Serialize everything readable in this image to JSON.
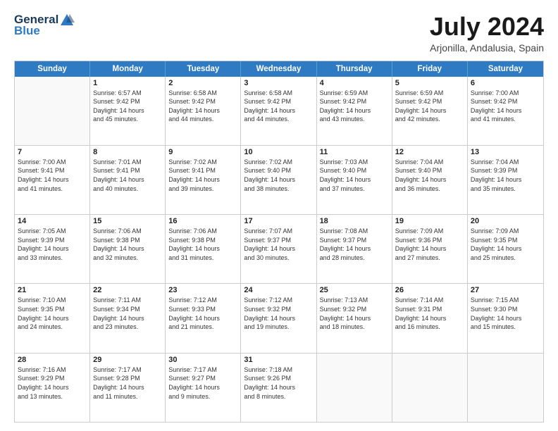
{
  "header": {
    "logo_general": "General",
    "logo_blue": "Blue",
    "month_title": "July 2024",
    "subtitle": "Arjonilla, Andalusia, Spain"
  },
  "calendar": {
    "days": [
      "Sunday",
      "Monday",
      "Tuesday",
      "Wednesday",
      "Thursday",
      "Friday",
      "Saturday"
    ],
    "rows": [
      [
        {
          "day": "",
          "lines": []
        },
        {
          "day": "1",
          "lines": [
            "Sunrise: 6:57 AM",
            "Sunset: 9:42 PM",
            "Daylight: 14 hours",
            "and 45 minutes."
          ]
        },
        {
          "day": "2",
          "lines": [
            "Sunrise: 6:58 AM",
            "Sunset: 9:42 PM",
            "Daylight: 14 hours",
            "and 44 minutes."
          ]
        },
        {
          "day": "3",
          "lines": [
            "Sunrise: 6:58 AM",
            "Sunset: 9:42 PM",
            "Daylight: 14 hours",
            "and 44 minutes."
          ]
        },
        {
          "day": "4",
          "lines": [
            "Sunrise: 6:59 AM",
            "Sunset: 9:42 PM",
            "Daylight: 14 hours",
            "and 43 minutes."
          ]
        },
        {
          "day": "5",
          "lines": [
            "Sunrise: 6:59 AM",
            "Sunset: 9:42 PM",
            "Daylight: 14 hours",
            "and 42 minutes."
          ]
        },
        {
          "day": "6",
          "lines": [
            "Sunrise: 7:00 AM",
            "Sunset: 9:42 PM",
            "Daylight: 14 hours",
            "and 41 minutes."
          ]
        }
      ],
      [
        {
          "day": "7",
          "lines": [
            "Sunrise: 7:00 AM",
            "Sunset: 9:41 PM",
            "Daylight: 14 hours",
            "and 41 minutes."
          ]
        },
        {
          "day": "8",
          "lines": [
            "Sunrise: 7:01 AM",
            "Sunset: 9:41 PM",
            "Daylight: 14 hours",
            "and 40 minutes."
          ]
        },
        {
          "day": "9",
          "lines": [
            "Sunrise: 7:02 AM",
            "Sunset: 9:41 PM",
            "Daylight: 14 hours",
            "and 39 minutes."
          ]
        },
        {
          "day": "10",
          "lines": [
            "Sunrise: 7:02 AM",
            "Sunset: 9:40 PM",
            "Daylight: 14 hours",
            "and 38 minutes."
          ]
        },
        {
          "day": "11",
          "lines": [
            "Sunrise: 7:03 AM",
            "Sunset: 9:40 PM",
            "Daylight: 14 hours",
            "and 37 minutes."
          ]
        },
        {
          "day": "12",
          "lines": [
            "Sunrise: 7:04 AM",
            "Sunset: 9:40 PM",
            "Daylight: 14 hours",
            "and 36 minutes."
          ]
        },
        {
          "day": "13",
          "lines": [
            "Sunrise: 7:04 AM",
            "Sunset: 9:39 PM",
            "Daylight: 14 hours",
            "and 35 minutes."
          ]
        }
      ],
      [
        {
          "day": "14",
          "lines": [
            "Sunrise: 7:05 AM",
            "Sunset: 9:39 PM",
            "Daylight: 14 hours",
            "and 33 minutes."
          ]
        },
        {
          "day": "15",
          "lines": [
            "Sunrise: 7:06 AM",
            "Sunset: 9:38 PM",
            "Daylight: 14 hours",
            "and 32 minutes."
          ]
        },
        {
          "day": "16",
          "lines": [
            "Sunrise: 7:06 AM",
            "Sunset: 9:38 PM",
            "Daylight: 14 hours",
            "and 31 minutes."
          ]
        },
        {
          "day": "17",
          "lines": [
            "Sunrise: 7:07 AM",
            "Sunset: 9:37 PM",
            "Daylight: 14 hours",
            "and 30 minutes."
          ]
        },
        {
          "day": "18",
          "lines": [
            "Sunrise: 7:08 AM",
            "Sunset: 9:37 PM",
            "Daylight: 14 hours",
            "and 28 minutes."
          ]
        },
        {
          "day": "19",
          "lines": [
            "Sunrise: 7:09 AM",
            "Sunset: 9:36 PM",
            "Daylight: 14 hours",
            "and 27 minutes."
          ]
        },
        {
          "day": "20",
          "lines": [
            "Sunrise: 7:09 AM",
            "Sunset: 9:35 PM",
            "Daylight: 14 hours",
            "and 25 minutes."
          ]
        }
      ],
      [
        {
          "day": "21",
          "lines": [
            "Sunrise: 7:10 AM",
            "Sunset: 9:35 PM",
            "Daylight: 14 hours",
            "and 24 minutes."
          ]
        },
        {
          "day": "22",
          "lines": [
            "Sunrise: 7:11 AM",
            "Sunset: 9:34 PM",
            "Daylight: 14 hours",
            "and 23 minutes."
          ]
        },
        {
          "day": "23",
          "lines": [
            "Sunrise: 7:12 AM",
            "Sunset: 9:33 PM",
            "Daylight: 14 hours",
            "and 21 minutes."
          ]
        },
        {
          "day": "24",
          "lines": [
            "Sunrise: 7:12 AM",
            "Sunset: 9:32 PM",
            "Daylight: 14 hours",
            "and 19 minutes."
          ]
        },
        {
          "day": "25",
          "lines": [
            "Sunrise: 7:13 AM",
            "Sunset: 9:32 PM",
            "Daylight: 14 hours",
            "and 18 minutes."
          ]
        },
        {
          "day": "26",
          "lines": [
            "Sunrise: 7:14 AM",
            "Sunset: 9:31 PM",
            "Daylight: 14 hours",
            "and 16 minutes."
          ]
        },
        {
          "day": "27",
          "lines": [
            "Sunrise: 7:15 AM",
            "Sunset: 9:30 PM",
            "Daylight: 14 hours",
            "and 15 minutes."
          ]
        }
      ],
      [
        {
          "day": "28",
          "lines": [
            "Sunrise: 7:16 AM",
            "Sunset: 9:29 PM",
            "Daylight: 14 hours",
            "and 13 minutes."
          ]
        },
        {
          "day": "29",
          "lines": [
            "Sunrise: 7:17 AM",
            "Sunset: 9:28 PM",
            "Daylight: 14 hours",
            "and 11 minutes."
          ]
        },
        {
          "day": "30",
          "lines": [
            "Sunrise: 7:17 AM",
            "Sunset: 9:27 PM",
            "Daylight: 14 hours",
            "and 9 minutes."
          ]
        },
        {
          "day": "31",
          "lines": [
            "Sunrise: 7:18 AM",
            "Sunset: 9:26 PM",
            "Daylight: 14 hours",
            "and 8 minutes."
          ]
        },
        {
          "day": "",
          "lines": []
        },
        {
          "day": "",
          "lines": []
        },
        {
          "day": "",
          "lines": []
        }
      ]
    ]
  }
}
